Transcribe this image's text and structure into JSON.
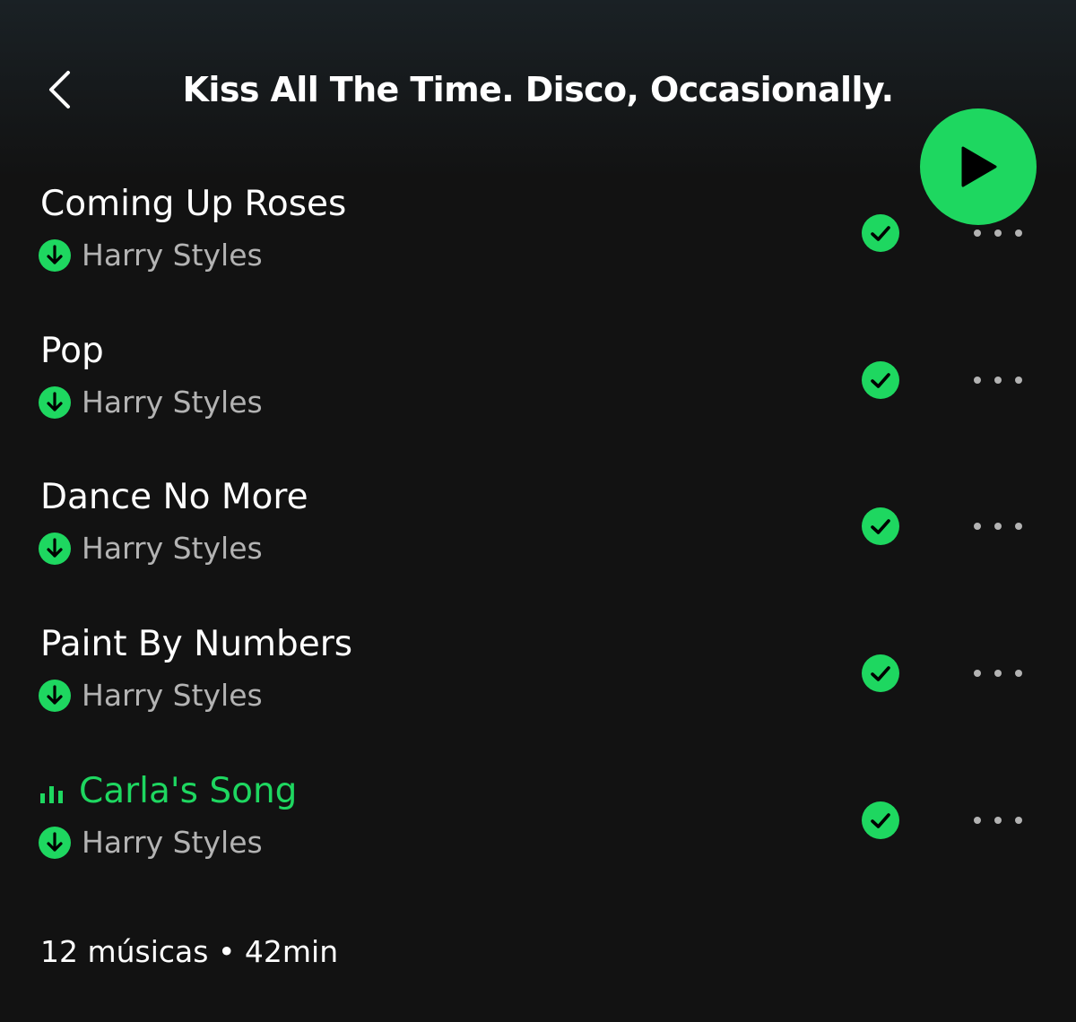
{
  "header": {
    "title": "Kiss All The Time. Disco, Occasionally.",
    "back_icon": "chevron-left-icon",
    "play_icon": "play-icon"
  },
  "colors": {
    "background": "#121212",
    "accent": "#1ed760",
    "secondary_text": "#b3b3b3"
  },
  "tracks": [
    {
      "title": "Coming Up Roses",
      "artist": "Harry Styles",
      "downloaded": true,
      "saved": true,
      "playing": false
    },
    {
      "title": "Pop",
      "artist": "Harry Styles",
      "downloaded": true,
      "saved": true,
      "playing": false
    },
    {
      "title": "Dance No More",
      "artist": "Harry Styles",
      "downloaded": true,
      "saved": true,
      "playing": false
    },
    {
      "title": "Paint By Numbers",
      "artist": "Harry Styles",
      "downloaded": true,
      "saved": true,
      "playing": false
    },
    {
      "title": "Carla's Song",
      "artist": "Harry Styles",
      "downloaded": true,
      "saved": true,
      "playing": true
    }
  ],
  "footer": {
    "summary": "12 músicas • 42min"
  }
}
